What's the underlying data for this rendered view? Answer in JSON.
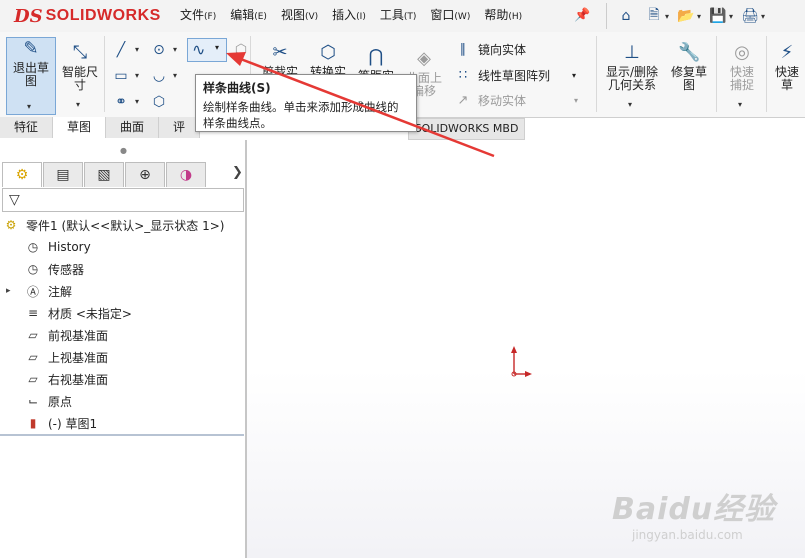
{
  "app": {
    "logo_text": "SOLIDWORKS",
    "logo_ds": "DS"
  },
  "menu": [
    {
      "label": "文件",
      "key": "(F)"
    },
    {
      "label": "编辑",
      "key": "(E)"
    },
    {
      "label": "视图",
      "key": "(V)"
    },
    {
      "label": "插入",
      "key": "(I)"
    },
    {
      "label": "工具",
      "key": "(T)"
    },
    {
      "label": "窗口",
      "key": "(W)"
    },
    {
      "label": "帮助",
      "key": "(H)"
    }
  ],
  "ribbon": {
    "exit_sketch": "退出草图",
    "smart_dim": "智能尺寸",
    "trim": "剪裁实",
    "convert": "转换实",
    "offset": "等距实",
    "surface_offset": "曲面上偏移",
    "mirror": "镜向实体",
    "linear_pattern": "线性草图阵列",
    "move": "移动实体",
    "show_relations": "显示/删除几何关系",
    "repair_sketch": "修复草图",
    "quick_snap": "快速捕捉",
    "quick_view": "快速草"
  },
  "tabs": [
    "特征",
    "草图",
    "曲面",
    "评"
  ],
  "mbd_tab": "SOLIDWORKS MBD",
  "tooltip": {
    "title": "样条曲线(S)",
    "desc": "绘制样条曲线。单击来添加形成曲线的样条曲线点。"
  },
  "tree": {
    "root": "零件1 (默认<<默认>_显示状态 1>)",
    "items": [
      "History",
      "传感器",
      "注解",
      "材质 <未指定>",
      "前视基准面",
      "上视基准面",
      "右视基准面",
      "原点",
      "(-) 草图1"
    ]
  },
  "watermark": {
    "brand": "Baidu经验",
    "url": "jingyan.baidu.com"
  },
  "colors": {
    "accent": "#1f4f86",
    "brand_red": "#d62a2a",
    "annotation_red": "#e53935"
  }
}
